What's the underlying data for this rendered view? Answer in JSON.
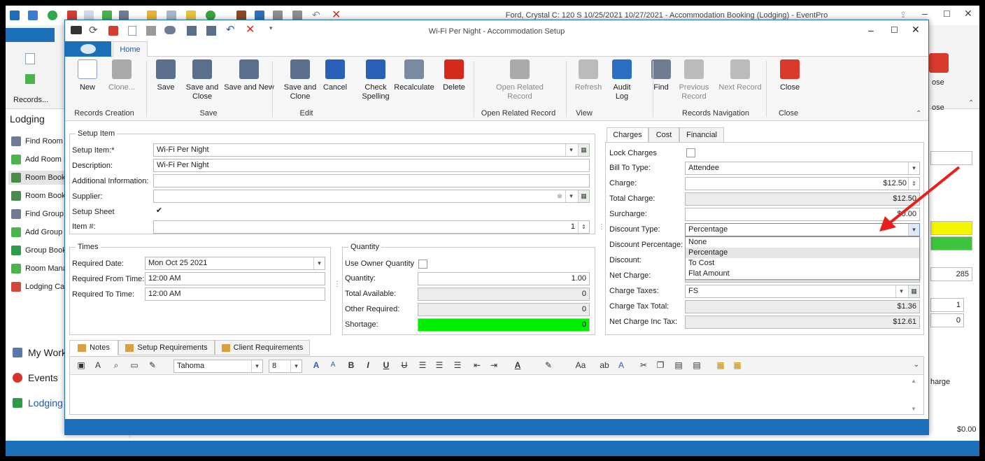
{
  "main_window": {
    "title": "Ford, Crystal C: 120 S 10/25/2021 10/27/2021  - Accommodation Booking (Lodging) - EventPro",
    "ribbon_group": "Records...",
    "nav_title": "Lodging",
    "nav_items": [
      "Find Room B",
      "Add Room B",
      "Room Booki",
      "Room Booki",
      "Find Group",
      "Add Group B",
      "Group Book",
      "Room Mana",
      "Lodging Cal"
    ],
    "big_nav": [
      "My Work",
      "Events",
      "Lodging"
    ],
    "right_frag": {
      "close": "ose",
      "close2": "ose",
      "v285": "285",
      "v1": "1",
      "v0": "0",
      "charge": "harge",
      "total": "$0.00"
    }
  },
  "dialog": {
    "title": "Wi-Fi Per Night - Accommodation Setup",
    "home_tab": "Home",
    "ribbon": [
      {
        "label": "New",
        "icon": "new-icon"
      },
      {
        "label": "Clone...",
        "icon": "clone-icon",
        "disabled": true
      },
      {
        "label": "Save",
        "icon": "save-icon"
      },
      {
        "label": "Save and Close",
        "icon": "save-close-icon"
      },
      {
        "label": "Save and New",
        "icon": "save-new-icon"
      },
      {
        "label": "Save and Clone",
        "icon": "save-clone-icon"
      },
      {
        "label": "Cancel",
        "icon": "undo-icon"
      },
      {
        "label": "Check Spelling",
        "icon": "spellcheck-icon"
      },
      {
        "label": "Recalculate",
        "icon": "calculator-icon"
      },
      {
        "label": "Delete",
        "icon": "delete-icon"
      },
      {
        "label": "Open Related Record",
        "icon": "related-icon",
        "disabled": true
      },
      {
        "label": "Refresh",
        "icon": "refresh-icon",
        "disabled": true
      },
      {
        "label": "Audit Log",
        "icon": "audit-icon"
      },
      {
        "label": "Find",
        "icon": "binoculars-icon"
      },
      {
        "label": "Previous Record",
        "icon": "up-icon",
        "disabled": true
      },
      {
        "label": "Next Record",
        "icon": "down-icon",
        "disabled": true
      },
      {
        "label": "Close",
        "icon": "close-icon"
      }
    ],
    "groups": [
      "Records Creation",
      "Save",
      "Edit",
      "Open Related Record",
      "View",
      "Records Navigation",
      "Close"
    ],
    "setup": {
      "legend": "Setup Item",
      "item_label": "Setup Item:*",
      "item": "Wi-Fi Per Night",
      "desc_label": "Description:",
      "desc": "Wi-Fi Per Night",
      "addl_label": "Additional Information:",
      "addl": "",
      "supplier_label": "Supplier:",
      "supplier": "",
      "sheet_label": "Setup Sheet",
      "sheet_checked": true,
      "itemno_label": "Item #:",
      "itemno": "1"
    },
    "times": {
      "legend": "Times",
      "date_label": "Required Date:",
      "date": "Mon Oct 25 2021",
      "from_label": "Required From Time:",
      "from": "12:00 AM",
      "to_label": "Required To Time:",
      "to": "12:00 AM"
    },
    "quantity": {
      "legend": "Quantity",
      "owner_label": "Use Owner Quantity",
      "qty_label": "Quantity:",
      "qty": "1.00",
      "avail_label": "Total Available:",
      "avail": "0",
      "other_label": "Other Required:",
      "other": "0",
      "short_label": "Shortage:",
      "short": "0",
      "short_color": "#00f000"
    },
    "tabs": [
      "Charges",
      "Cost",
      "Financial"
    ],
    "charges": {
      "lock_label": "Lock Charges",
      "billto_label": "Bill To Type:",
      "billto": "Attendee",
      "charge_label": "Charge:",
      "charge": "$12.50",
      "total_label": "Total Charge:",
      "total": "$12.50",
      "surcharge_label": "Surcharge:",
      "surcharge": "$0.00",
      "disctype_label": "Discount Type:",
      "disctype": "Percentage",
      "discpct_label": "Discount Percentage:",
      "disc_label": "Discount:",
      "net_label": "Net Charge:",
      "taxes_label": "Charge Taxes:",
      "taxes": "FS",
      "taxtotal_label": "Charge Tax Total:",
      "taxtotal": "$1.36",
      "netinc_label": "Net Charge Inc Tax:",
      "netinc": "$12.61",
      "options": [
        "None",
        "Percentage",
        "To Cost",
        "Flat Amount"
      ],
      "selected": "Percentage"
    },
    "notes_tabs": [
      "Notes",
      "Setup Requirements",
      "Client Requirements"
    ],
    "editor": {
      "font": "Tahoma",
      "size": "8"
    }
  }
}
